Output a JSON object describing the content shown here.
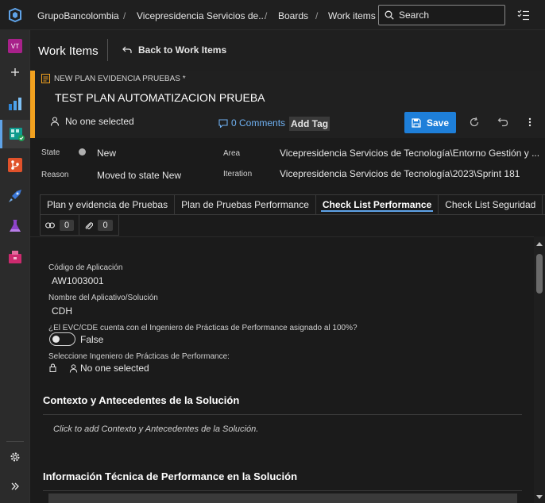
{
  "topbar": {
    "breadcrumbs": [
      "GrupoBancolombia",
      "Vicepresidencia Servicios de...",
      "Boards",
      "Work items"
    ],
    "search_placeholder": "Search"
  },
  "rail": {
    "avatar_initials": "VT",
    "items": [
      "plus-icon",
      "overview-icon",
      "boards-icon",
      "repos-icon",
      "pipelines-icon",
      "test-plans-icon",
      "artifacts-icon"
    ],
    "bottom": [
      "settings-icon",
      "expand-icon"
    ]
  },
  "header": {
    "title": "Work Items",
    "back_label": "Back to Work Items"
  },
  "work_item": {
    "type_label": "NEW PLAN EVIDENCIA PRUEBAS *",
    "title": "TEST PLAN AUTOMATIZACION PRUEBA",
    "assigned": "No one selected",
    "comments": "0 Comments",
    "add_tag": "Add Tag",
    "save_label": "Save",
    "accent_color": "#f2a11f"
  },
  "fields": {
    "state_label": "State",
    "state_value": "New",
    "reason_label": "Reason",
    "reason_value": "Moved to state New",
    "area_label": "Area",
    "area_value": "Vicepresidencia Servicios de Tecnología\\Entorno Gestión y ...",
    "iteration_label": "Iteration",
    "iteration_value": "Vicepresidencia Servicios de Tecnología\\2023\\Sprint 181"
  },
  "tabs": [
    {
      "label": "Plan y evidencia de Pruebas"
    },
    {
      "label": "Plan de Pruebas Performance"
    },
    {
      "label": "Check List Performance"
    },
    {
      "label": "Check List Seguridad"
    }
  ],
  "link_tabs": {
    "links_count": "0",
    "attachments_count": "0"
  },
  "form": {
    "app_code_label": "Código de Aplicación",
    "app_code_value": "AW1003001",
    "app_name_label": "Nombre del Aplicativo/Solución",
    "app_name_value": "CDH",
    "question_label": "¿El EVC/CDE cuenta con el Ingeniero de Prácticas de Performance asignado al 100%?",
    "toggle_value": "False",
    "engineer_label": "Seleccione Ingeniero de Prácticas de Performance:",
    "engineer_value": "No one selected",
    "section1_title": "Contexto y Antecedentes de la Solución",
    "section1_placeholder": "Click to add Contexto y Antecedentes de la Solución.",
    "section2_title": "Información Técnica de Performance en la Solución"
  }
}
